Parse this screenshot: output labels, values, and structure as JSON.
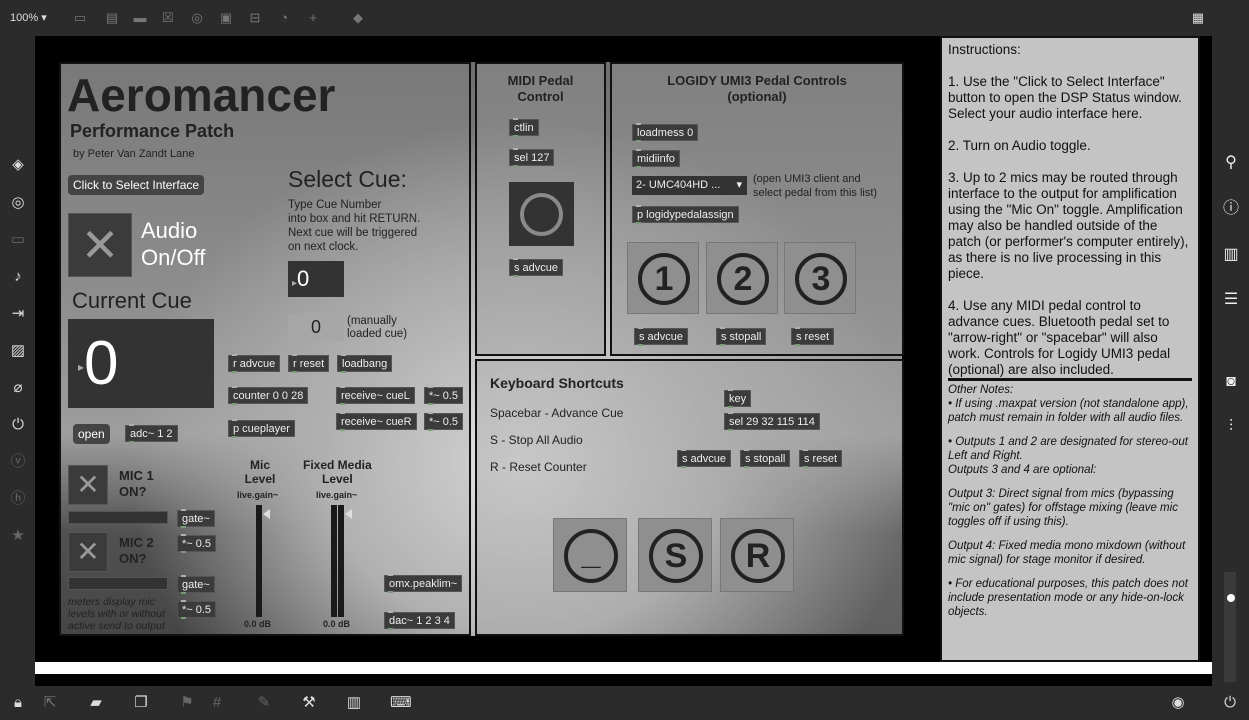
{
  "toolbar": {
    "zoom": "100%"
  },
  "title_block": {
    "title": "Aeromancer",
    "subtitle": "Performance Patch",
    "author": "by Peter Van Zandt Lane"
  },
  "interface_button": "Click to Select Interface",
  "audio_toggle": {
    "label_line1": "Audio",
    "label_line2": "On/Off"
  },
  "current_cue": {
    "label": "Current Cue",
    "value": "0"
  },
  "select_cue": {
    "title": "Select Cue:",
    "instructions_line1": "Type Cue Number",
    "instructions_line2": "into box and hit RETURN.",
    "instructions_line3": "Next cue will be triggered",
    "instructions_line4": "on next clock.",
    "value": "0",
    "loaded_value": "0",
    "loaded_label_line1": "(manually",
    "loaded_label_line2": "loaded cue)"
  },
  "objects": {
    "r_advcue": "r advcue",
    "r_reset": "r reset",
    "loadbang": "loadbang",
    "counter": "counter 0 0 28",
    "receive_cueL": "receive~ cueL",
    "mul1": "*~ 0.5",
    "receive_cueR": "receive~ cueR",
    "mul2": "*~ 0.5",
    "cueplayer": "p cueplayer",
    "open": "open",
    "adc": "adc~ 1 2",
    "gate1": "gate~",
    "mul3": "*~ 0.5",
    "gate2": "gate~",
    "mul4": "*~ 0.5",
    "peaklim": "omx.peaklim~",
    "dac": "dac~ 1 2 3 4"
  },
  "mics": {
    "mic1_line1": "MIC 1",
    "mic1_line2": "ON?",
    "mic2_line1": "MIC 2",
    "mic2_line2": "ON?",
    "meters_note_line1": "meters display mic",
    "meters_note_line2": "levels with or without",
    "meters_note_line3": "active send to output"
  },
  "levels": {
    "mic_title_line1": "Mic",
    "mic_title_line2": "Level",
    "mic_gain_label": "live.gain~",
    "mic_db": "0.0 dB",
    "media_title_line1": "Fixed Media",
    "media_title_line2": "Level",
    "media_gain_label": "live.gain~",
    "media_db": "0.0 dB"
  },
  "midi_pedal": {
    "title_line1": "MIDI Pedal",
    "title_line2": "Control",
    "ctlin": "ctlin",
    "sel": "sel 127",
    "advcue": "s advcue"
  },
  "logidy": {
    "title_line1": "LOGIDY UMI3 Pedal Controls",
    "title_line2": "(optional)",
    "loadmess": "loadmess 0",
    "midiinfo": "midiinfo",
    "menu_value": "2- UMC404HD ...",
    "menu_note_line1": "(open UMI3 client and",
    "menu_note_line2": "select pedal from this list)",
    "assign": "p logidypedalassign",
    "btn1": "1",
    "btn2": "2",
    "btn3": "3",
    "s_advcue": "s advcue",
    "s_stopall": "s stopall",
    "s_reset": "s reset"
  },
  "keyboard": {
    "title": "Keyboard Shortcuts",
    "line1": "Spacebar - Advance Cue",
    "line2": "S - Stop All Audio",
    "line3": "R - Reset Counter",
    "key": "key",
    "sel": "sel 29 32 115 114",
    "s_advcue": "s advcue",
    "s_stopall": "s stopall",
    "s_reset": "s reset",
    "btn_space": "_",
    "btn_s": "S",
    "btn_r": "R"
  },
  "instructions": {
    "heading": "Instructions:",
    "step1": "1. Use the \"Click to Select Interface\" button to open the DSP Status window. Select your audio interface here.",
    "step2": "2. Turn on Audio toggle.",
    "step3": "3. Up to 2 mics may be routed through interface to the output for amplification using the \"Mic On\" toggle. Amplification may also be handled outside of the patch (or performer's computer entirely), as there is no live processing in this piece.",
    "step4": "4. Use any MIDI pedal control to advance cues. Bluetooth pedal set to \"arrow-right\" or \"spacebar\" will also work. Controls for Logidy UMI3 pedal (optional) are also included.",
    "notes_heading": "Other Notes:",
    "note1": "• If using .maxpat version (not standalone app), patch must remain in folder with all audio files.",
    "note2a": "• Outputs 1 and 2 are designated for stereo-out Left and Right.",
    "note2b": "Outputs 3 and 4 are optional:",
    "note3": "Output 3: Direct signal from mics (bypassing \"mic on\" gates) for offstage mixing (leave mic toggles off if using this).",
    "note4": "Output 4: Fixed media mono mixdown (without mic signal) for stage monitor if desired.",
    "note5": "• For educational purposes, this patch does not include presentation mode or any hide-on-lock objects."
  },
  "colors": {
    "chrome": "#2b2b2b",
    "panel": "#969696",
    "object": "#3b3b3b",
    "instructions_bg": "#c4c4c4"
  },
  "icons": {
    "left": [
      "cube-icon",
      "target-icon",
      "window-icon",
      "note-icon",
      "step-icon",
      "image-icon",
      "clip-icon",
      "plug-icon",
      "v-icon",
      "h-icon",
      "star-icon"
    ],
    "right": [
      "search-icon",
      "info-icon",
      "book-icon",
      "list-icon",
      "camera-icon",
      "sliders-icon"
    ],
    "bottom": [
      "lock-icon",
      "edit-icon",
      "chat-icon",
      "layers-icon",
      "grid-icon",
      "wrench-icon",
      "piano-icon",
      "keyboard-icon",
      "play-icon",
      "power-icon"
    ]
  }
}
